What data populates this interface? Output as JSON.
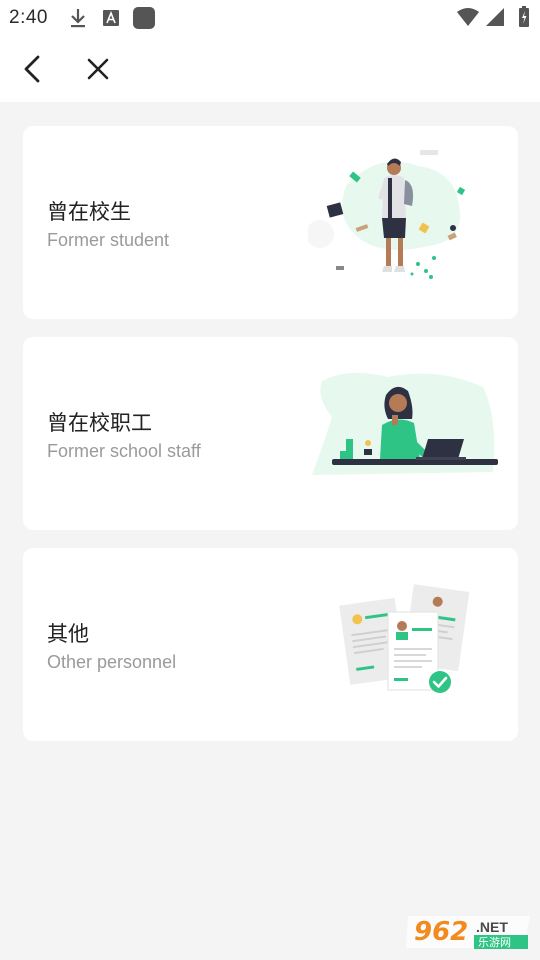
{
  "status_bar": {
    "time": "2:40",
    "icons": [
      "download-icon",
      "a-badge-icon",
      "app-square-icon",
      "wifi-icon",
      "cell-signal-icon",
      "battery-icon"
    ]
  },
  "nav": {
    "back_icon": "chevron-left-icon",
    "close_icon": "close-icon"
  },
  "options": [
    {
      "title": "曾在校生",
      "subtitle": "Former student",
      "illustration": "student-with-backpack"
    },
    {
      "title": "曾在校职工",
      "subtitle": "Former school staff",
      "illustration": "staff-at-desk-with-laptop"
    },
    {
      "title": "其他",
      "subtitle": "Other personnel",
      "illustration": "resume-documents-with-check"
    }
  ],
  "watermark": {
    "number": "962",
    "suffix": ".NET",
    "site_name": "乐游网"
  },
  "colors": {
    "accent_green": "#2ec486",
    "card_bg": "#ffffff",
    "page_bg": "#f4f4f4",
    "watermark_orange": "#f28a1e"
  }
}
